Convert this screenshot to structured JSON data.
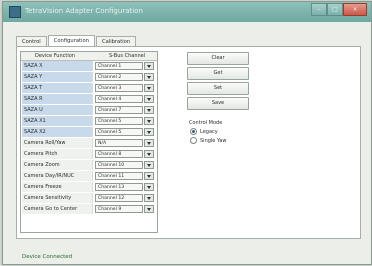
{
  "window": {
    "title": "TetraVision Adapter Configuration",
    "buttons": [
      "–",
      "□",
      "×"
    ]
  },
  "tabs": [
    {
      "label": "Control",
      "active": false
    },
    {
      "label": "Configuration",
      "active": true
    },
    {
      "label": "Calibration",
      "active": false
    }
  ],
  "grid": {
    "headers": [
      "Device Function",
      "S-Bus Channel"
    ],
    "rows": [
      {
        "function": "SAZA X",
        "channel": "Channel 1",
        "selected": true
      },
      {
        "function": "SAZA Y",
        "channel": "Channel 2",
        "selected": true
      },
      {
        "function": "SAZA T",
        "channel": "Channel 3",
        "selected": true
      },
      {
        "function": "SAZA R",
        "channel": "Channel 4",
        "selected": true
      },
      {
        "function": "SAZA U",
        "channel": "Channel 7",
        "selected": true
      },
      {
        "function": "SAZA X1",
        "channel": "Channel 5",
        "selected": true
      },
      {
        "function": "SAZA X2",
        "channel": "Channel 5",
        "selected": true
      },
      {
        "function": "Camera Roll/Yaw",
        "channel": "N/A",
        "selected": false
      },
      {
        "function": "Camera Pitch",
        "channel": "Channel 8",
        "selected": false
      },
      {
        "function": "Camera Zoom",
        "channel": "Channel 10",
        "selected": false
      },
      {
        "function": "Camera Day/IR/NUC",
        "channel": "Channel 11",
        "selected": false
      },
      {
        "function": "Camera Freeze",
        "channel": "Channel 13",
        "selected": false
      },
      {
        "function": "Camera Sensitivity",
        "channel": "Channel 12",
        "selected": false
      },
      {
        "function": "Camera Go to Center",
        "channel": "Channel 9",
        "selected": false
      }
    ]
  },
  "actions": {
    "clear": "Clear",
    "get": "Get",
    "set": "Set",
    "save": "Save"
  },
  "control_mode": {
    "label": "Control Mode",
    "options": [
      {
        "label": "Legacy",
        "checked": true
      },
      {
        "label": "Single Yaw",
        "checked": false
      }
    ]
  },
  "status": "Device Connected"
}
